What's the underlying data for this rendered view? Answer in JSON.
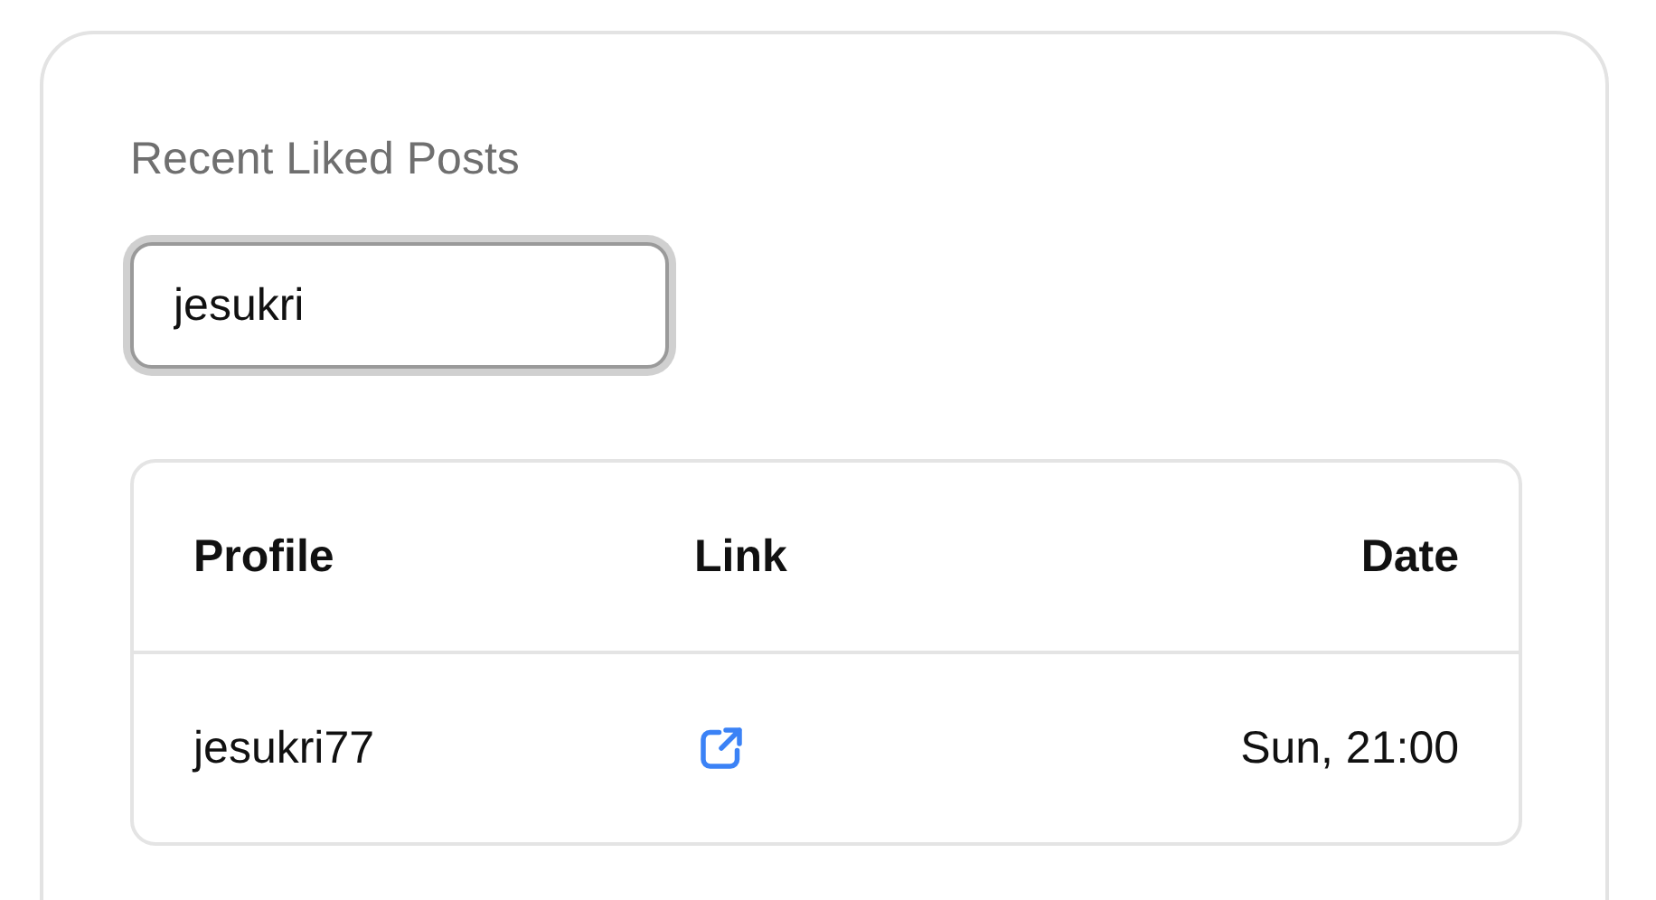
{
  "section": {
    "title": "Recent Liked Posts"
  },
  "search": {
    "value": "jesukri"
  },
  "table": {
    "columns": [
      "Profile",
      "Link",
      "Date"
    ],
    "rows": [
      {
        "profile": "jesukri77",
        "date": "Sun, 21:00"
      }
    ]
  }
}
